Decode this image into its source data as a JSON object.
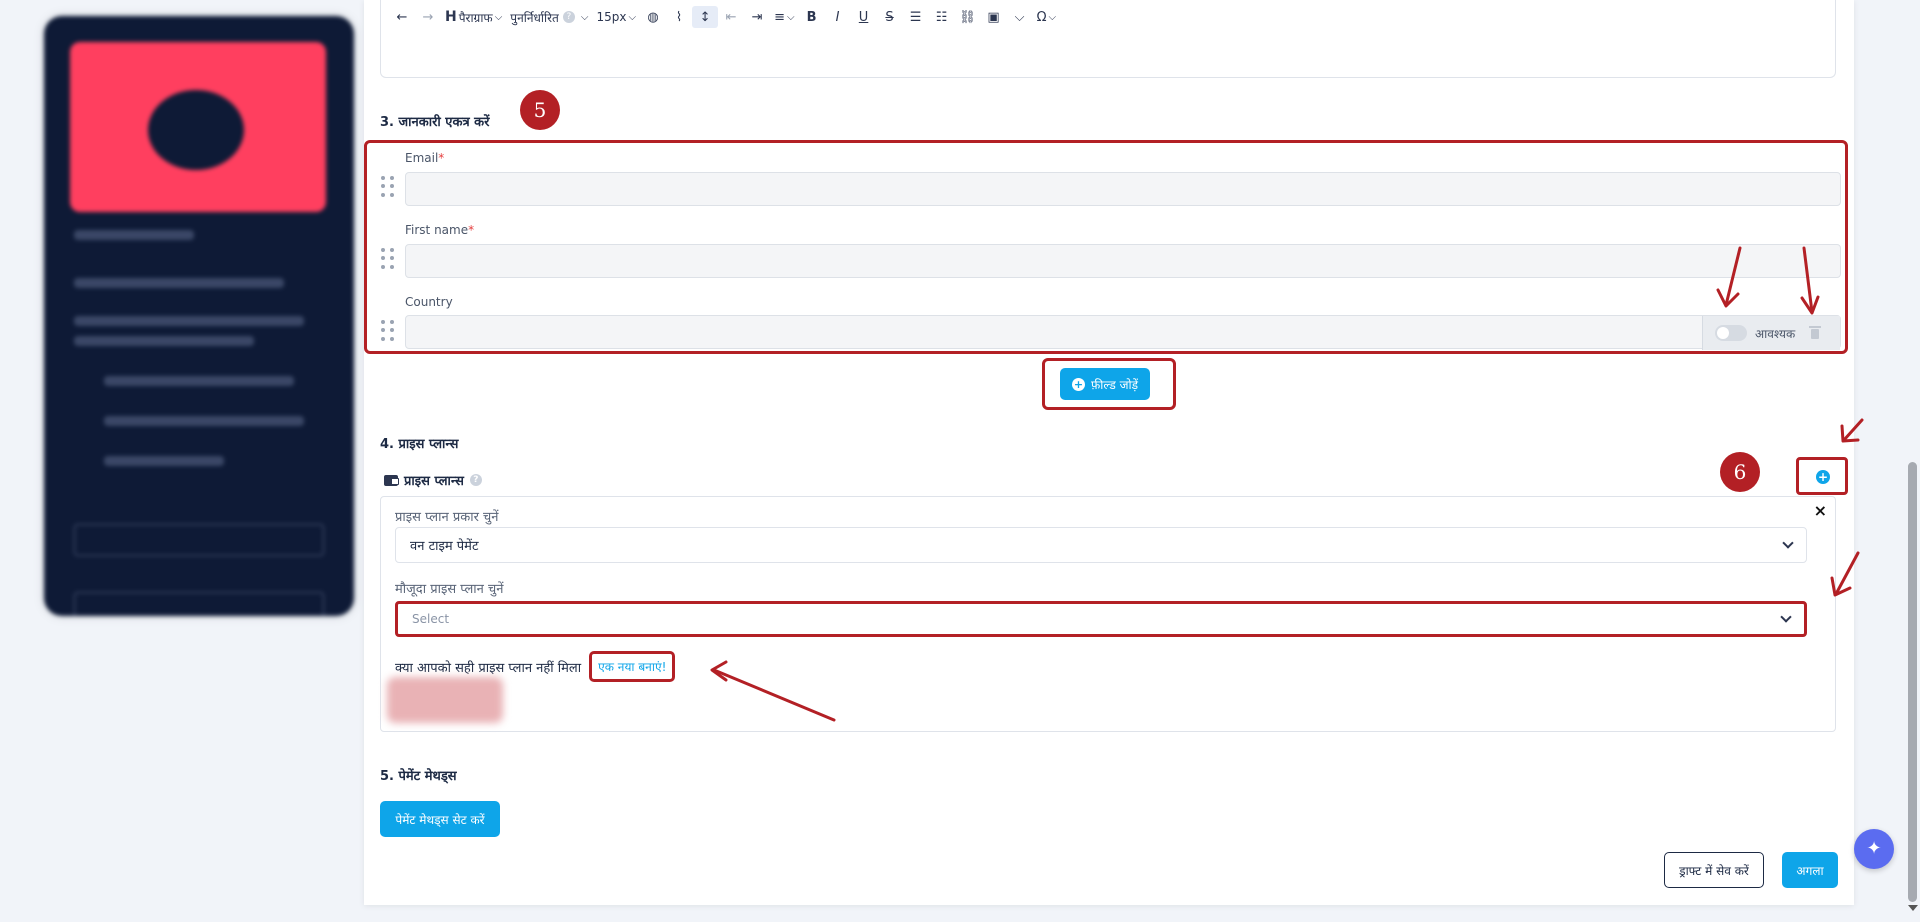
{
  "toolbar": {
    "paragraph_label": "पैराग्राफ",
    "reset_label": "पुनर्निर्धारित",
    "font_size": "15px"
  },
  "sections": {
    "collect_info_title": "3. जानकारी एकत्र करें",
    "price_plans_title": "4. प्राइस प्लान्स",
    "payment_methods_title": "5. पेमेंट मेथड्स"
  },
  "fields": [
    {
      "label": "Email",
      "required": true
    },
    {
      "label": "First name",
      "required": true
    },
    {
      "label": "Country",
      "required": false
    }
  ],
  "field_actions": {
    "required_label": "आवश्यक"
  },
  "add_field_label": "फ़ील्ड जोड़ें",
  "price_plans": {
    "header_label": "प्राइस प्लान्स",
    "type_label": "प्राइस प्लान प्रकार चुनें",
    "type_value": "वन टाइम पेमेंट",
    "existing_label": "मौजूदा प्राइस प्लान चुनें",
    "existing_placeholder": "Select",
    "not_found_text": "क्या आपको सही प्राइस प्लान नहीं मिला",
    "create_new_link": "एक नया बनाएं!",
    "close_symbol": "×"
  },
  "payment_setup_label": "पेमेंट मेथड्स सेट करें",
  "footer": {
    "save_draft_label": "ड्राफ्ट में सेव करें",
    "next_label": "अगला"
  },
  "annotations": {
    "badge_5": "5",
    "badge_6": "6"
  },
  "colors": {
    "accent": "#0ea5e9",
    "annotation_red": "#b32025",
    "preview_pink": "#ff3f5f",
    "preview_navy": "#0e1a36"
  }
}
